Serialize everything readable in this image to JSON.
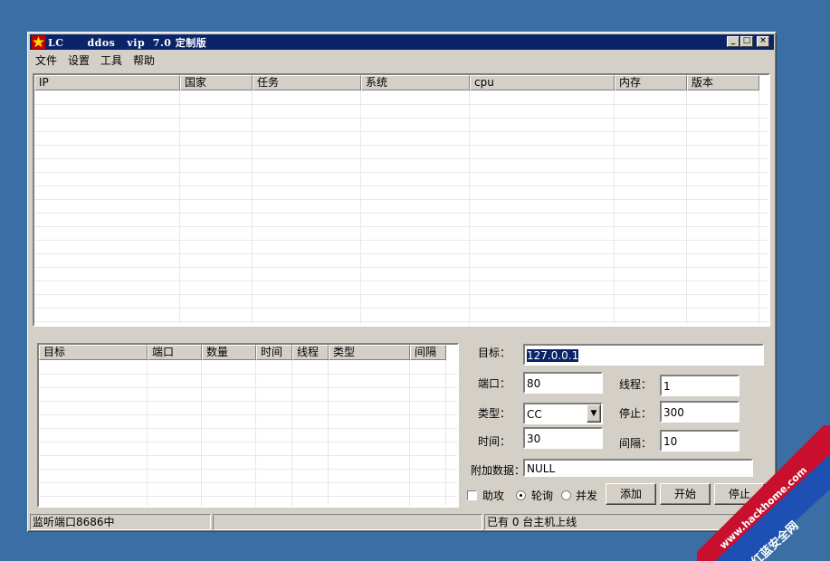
{
  "window": {
    "title": "LC      ddos   vip  7.0 定制版",
    "min_label": "_",
    "max_label": "□",
    "close_label": "×"
  },
  "menu": [
    "文件",
    "设置",
    "工具",
    "帮助"
  ],
  "hosts_table": {
    "columns": [
      "IP",
      "国家",
      "任务",
      "系统",
      "cpu",
      "内存",
      "版本"
    ],
    "rows": []
  },
  "targets_table": {
    "columns": [
      "目标",
      "端口",
      "数量",
      "时间",
      "线程",
      "类型",
      "间隔"
    ],
    "rows": []
  },
  "form": {
    "target_label": "目标：",
    "target_value": "127.0.0.1",
    "port_label": "端口：",
    "port_value": "80",
    "threads_label": "线程：",
    "threads_value": "1",
    "type_label": "类型：",
    "type_value": "CC",
    "stop_label": "停止：",
    "stop_value": "300",
    "time_label": "时间：",
    "time_value": "30",
    "interval_label": "间隔：",
    "interval_value": "10",
    "extra_label": "附加数据：",
    "extra_value": "NULL",
    "assist_label": "助攻",
    "assist_checked": false,
    "poll_label": "轮询",
    "concurrent_label": "并发",
    "mode_selected": "轮询",
    "add_button": "添加",
    "start_button": "开始",
    "stop_button": "停止"
  },
  "status": {
    "listen": "监听端口8686中",
    "middle": "",
    "online": "已有  0  台主机上线"
  },
  "watermark": {
    "url": "www.hackhome.com",
    "name": "红蓝安全网"
  },
  "colors": {
    "desktop": "#3a6ea5",
    "titlebar": "#0a246a",
    "face": "#d4d0c8"
  }
}
